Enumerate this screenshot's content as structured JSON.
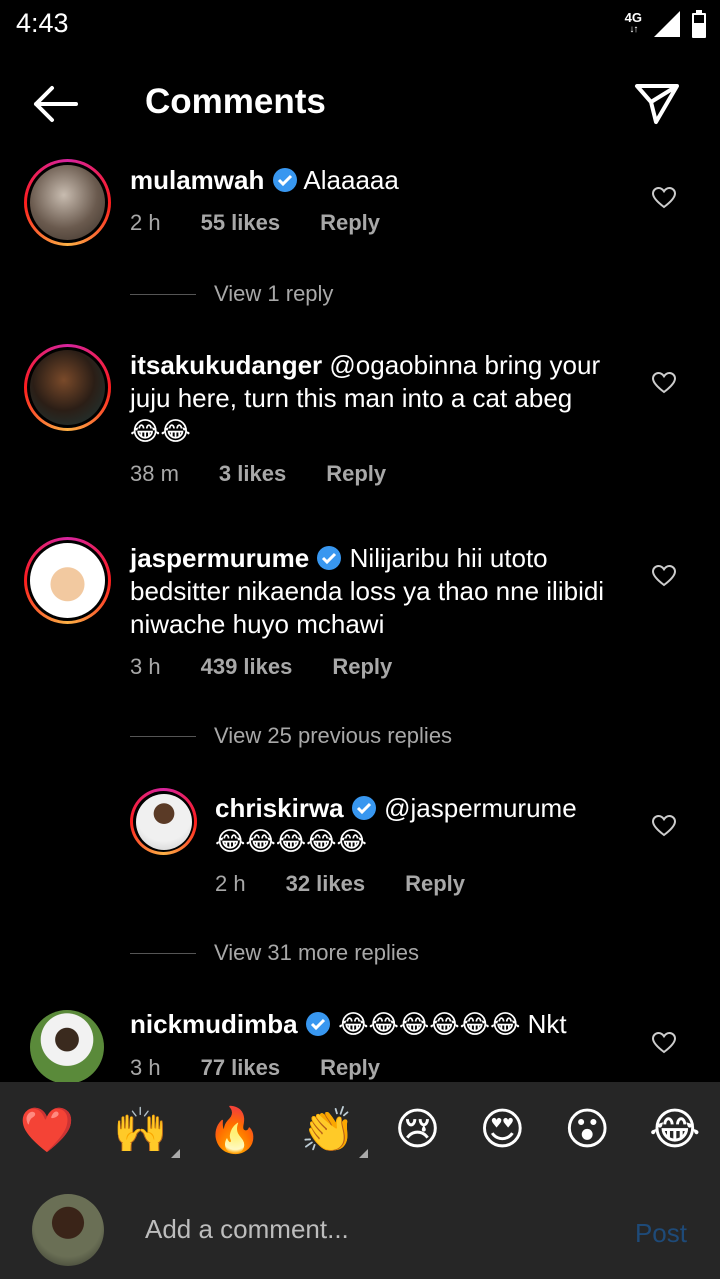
{
  "status": {
    "time": "4:43",
    "network": "4G"
  },
  "header": {
    "title": "Comments"
  },
  "comments": [
    {
      "username": "mulamwah",
      "text": "Alaaaaa",
      "time": "2 h",
      "likes": "55 likes",
      "reply": "Reply",
      "view_replies": "View 1 reply"
    },
    {
      "username": "itsakukudanger",
      "mention": "@ogaobinna",
      "text": " bring your juju here, turn this man into a cat abeg",
      "emoji": "😂😂",
      "time": "38 m",
      "likes": "3 likes",
      "reply": "Reply"
    },
    {
      "username": "jaspermurume",
      "text": "Nilijaribu hii utoto bedsitter nikaenda loss ya thao nne ilibidi niwache huyo mchawi",
      "time": "3 h",
      "likes": "439 likes",
      "reply": "Reply",
      "view_previous": "View 25 previous replies"
    },
    {
      "username": "chriskirwa",
      "mention": "@jaspermurume",
      "emoji": "😂😂😂😂😂",
      "time": "2 h",
      "likes": "32 likes",
      "reply": "Reply",
      "view_more": "View 31 more replies"
    },
    {
      "username": "nickmudimba",
      "emoji": "😂😂😂😂😂😂",
      "text": " Nkt",
      "time": "3 h",
      "likes": "77 likes",
      "reply": "Reply"
    }
  ],
  "reactions": [
    "❤️",
    "🙌",
    "🔥",
    "👏",
    "😢",
    "😍",
    "😮",
    "😂"
  ],
  "composer": {
    "placeholder": "Add a comment...",
    "post_label": "Post"
  },
  "colors": {
    "verified": "#3897f0",
    "post_disabled": "#1e4a78",
    "bar_bg": "#262626"
  }
}
